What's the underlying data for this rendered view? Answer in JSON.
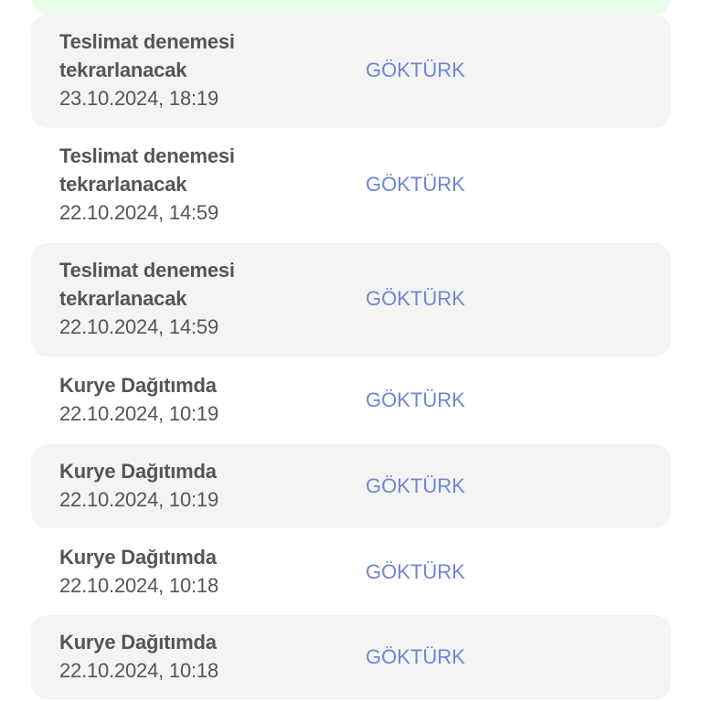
{
  "events": [
    {
      "status_line1": "Teslimat denemesi",
      "status_line2": "tekrarlanacak",
      "datetime": "23.10.2024, 18:19",
      "location": "GÖKTÜRK"
    },
    {
      "status_line1": "Teslimat denemesi",
      "status_line2": "tekrarlanacak",
      "datetime": "22.10.2024, 14:59",
      "location": "GÖKTÜRK"
    },
    {
      "status_line1": "Teslimat denemesi",
      "status_line2": "tekrarlanacak",
      "datetime": "22.10.2024, 14:59",
      "location": "GÖKTÜRK"
    },
    {
      "status_line1": "Kurye Dağıtımda",
      "status_line2": "",
      "datetime": "22.10.2024, 10:19",
      "location": "GÖKTÜRK"
    },
    {
      "status_line1": "Kurye Dağıtımda",
      "status_line2": "",
      "datetime": "22.10.2024, 10:19",
      "location": "GÖKTÜRK"
    },
    {
      "status_line1": "Kurye Dağıtımda",
      "status_line2": "",
      "datetime": "22.10.2024, 10:18",
      "location": "GÖKTÜRK"
    },
    {
      "status_line1": "Kurye Dağıtımda",
      "status_line2": "",
      "datetime": "22.10.2024, 10:18",
      "location": "GÖKTÜRK"
    }
  ],
  "colors": {
    "status_text": "#555555",
    "location_text": "#6f86d6",
    "row_shade": "#f4f4f4",
    "top_banner": "#e9fbe9"
  }
}
